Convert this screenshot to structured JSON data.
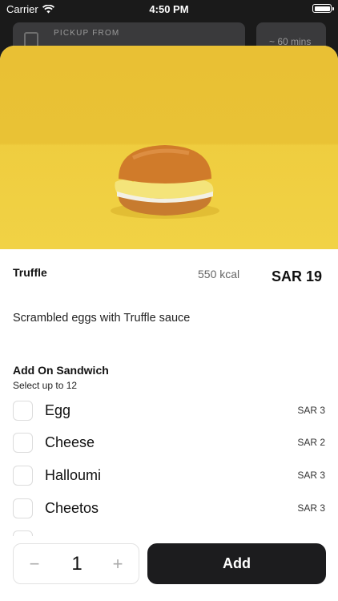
{
  "status_bar": {
    "carrier": "Carrier",
    "time": "4:50 PM"
  },
  "pickup": {
    "label": "PICKUP FROM",
    "eta": "~ 60 mins"
  },
  "item": {
    "name": "Truffle",
    "kcal": "550 kcal",
    "price": "SAR 19",
    "description": "Scrambled eggs with Truffle sauce"
  },
  "addons": {
    "heading": "Add On Sandwich",
    "subheading": "Select up to 12",
    "options": [
      {
        "label": "Egg",
        "price": "SAR 3"
      },
      {
        "label": "Cheese",
        "price": "SAR 2"
      },
      {
        "label": "Halloumi",
        "price": "SAR 3"
      },
      {
        "label": "Cheetos",
        "price": "SAR 3"
      }
    ]
  },
  "order": {
    "quantity": "1",
    "minus": "−",
    "plus": "+",
    "add_label": "Add"
  },
  "colors": {
    "hero_background": "#e9c034",
    "button_dark": "#1c1c1e"
  }
}
